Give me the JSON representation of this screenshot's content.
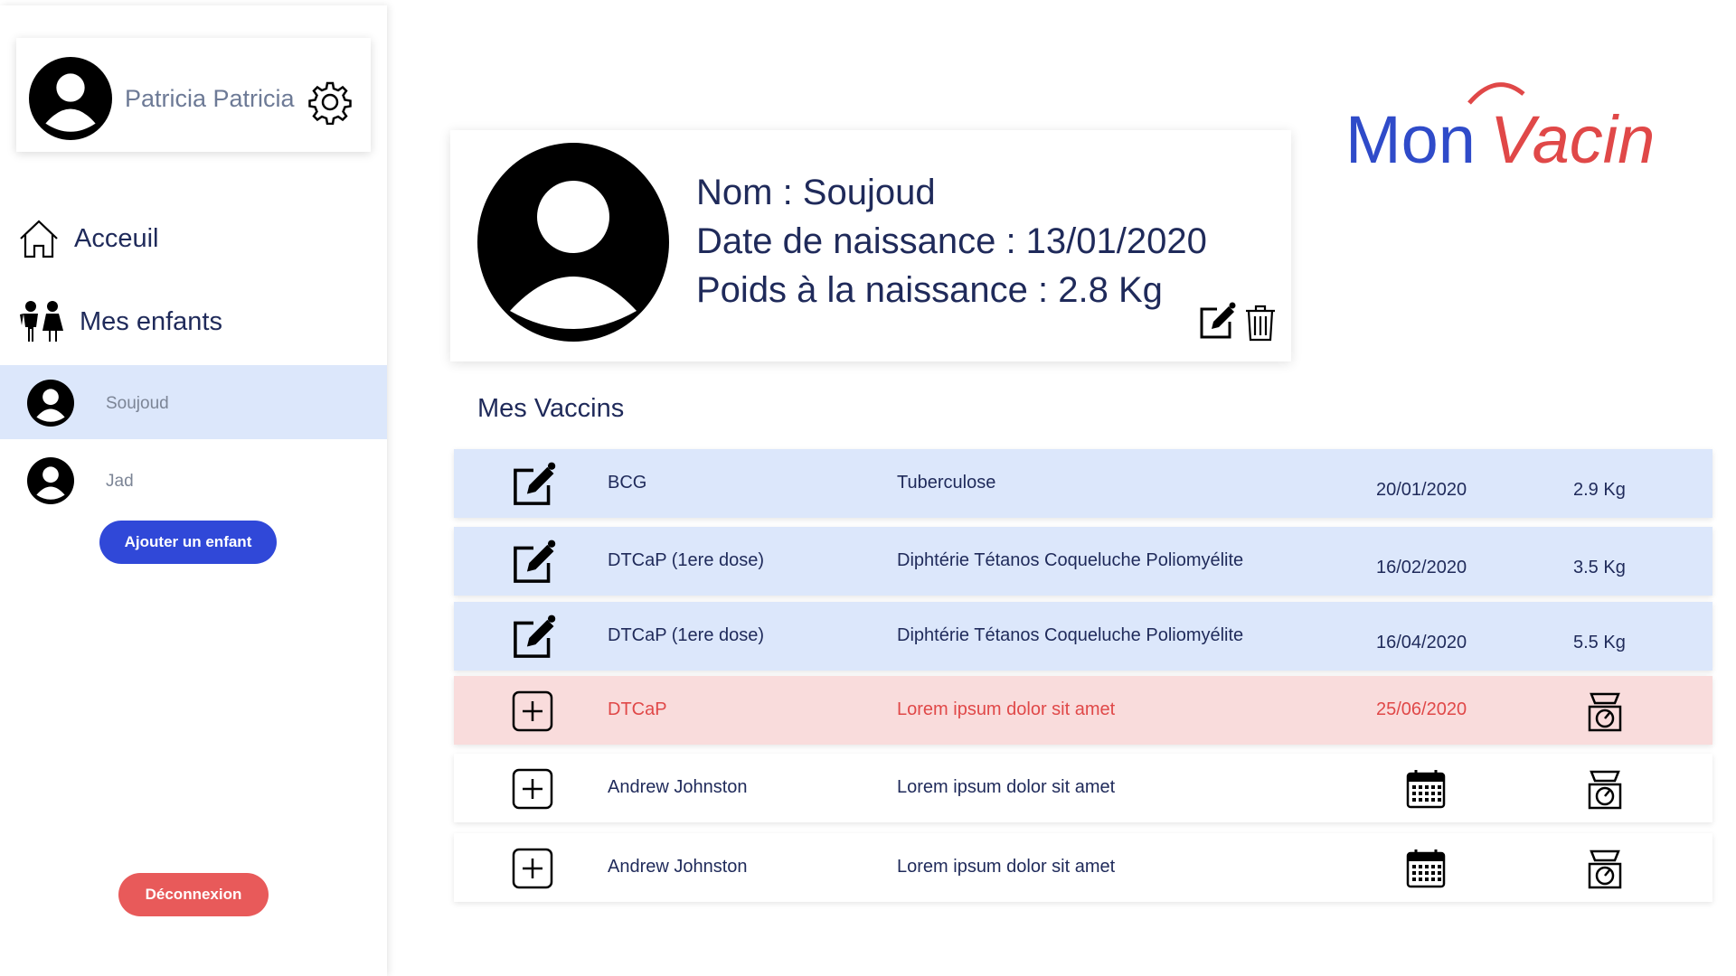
{
  "user": {
    "name": "Patricia Patricia"
  },
  "nav": {
    "home_label": "Acceuil",
    "kids_label": "Mes enfants"
  },
  "children": [
    {
      "name": "Soujoud",
      "active": true
    },
    {
      "name": "Jad",
      "active": false
    }
  ],
  "buttons": {
    "add_child": "Ajouter un enfant",
    "logout": "Déconnexion"
  },
  "child_card": {
    "name_line": "Nom : Soujoud",
    "birth_line": "Date de naissance : 13/01/2020",
    "weight_line": "Poids à la naissance : 2.8 Kg"
  },
  "logo": {
    "part1": "Mon",
    "part2": "Vacin"
  },
  "vaccines_title": "Mes Vaccins",
  "vaccines": [
    {
      "name": "BCG",
      "desc": "Tuberculose",
      "date": "20/01/2020",
      "weight": "2.9 Kg",
      "status": "done"
    },
    {
      "name": "DTCaP (1ere dose)",
      "desc": "Diphtérie Tétanos Coqueluche Poliomyélite",
      "date": "16/02/2020",
      "weight": "3.5 Kg",
      "status": "done"
    },
    {
      "name": "DTCaP (1ere dose)",
      "desc": "Diphtérie Tétanos Coqueluche Poliomyélite",
      "date": "16/04/2020",
      "weight": "5.5 Kg",
      "status": "done"
    },
    {
      "name": "DTCaP",
      "desc": "Lorem ipsum dolor sit amet",
      "date": "25/06/2020",
      "weight": "",
      "status": "due"
    },
    {
      "name": "Andrew Johnston",
      "desc": "Lorem ipsum dolor sit amet",
      "date": "",
      "weight": "",
      "status": "todo"
    },
    {
      "name": "Andrew Johnston",
      "desc": "Lorem ipsum dolor sit amet",
      "date": "",
      "weight": "",
      "status": "todo"
    }
  ],
  "colors": {
    "primary": "#3048d8",
    "logout": "#e85a5a",
    "row_done": "#dce7fb",
    "row_due": "#f9dcdc",
    "logo_blue": "#2f4bc9",
    "logo_red": "#e04848"
  },
  "icons": {
    "settings": "gear-icon",
    "home": "home-icon",
    "kids": "children-icon",
    "edit": "edit-icon",
    "delete": "trash-icon",
    "add": "plus-square-icon",
    "date": "calendar-icon",
    "weight": "scale-icon"
  }
}
